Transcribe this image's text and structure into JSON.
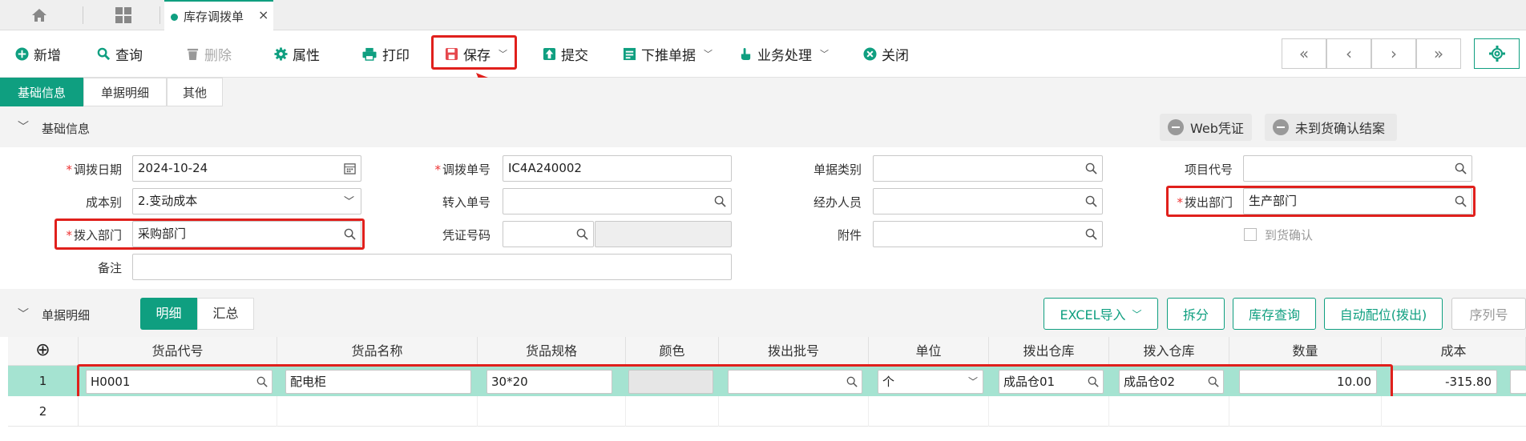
{
  "tabbar": {
    "active_tab": "库存调拨单",
    "close": "×"
  },
  "toolbar": {
    "add": "新增",
    "query": "查询",
    "delete": "删除",
    "properties": "属性",
    "print": "打印",
    "save": "保存",
    "submit": "提交",
    "push_down": "下推单据",
    "business": "业务处理",
    "close": "关闭",
    "nav_first": "«",
    "nav_prev": "‹",
    "nav_next": "›",
    "nav_last": "»"
  },
  "form_tabs": [
    "基础信息",
    "单据明细",
    "其他"
  ],
  "section_basic": {
    "title": "基础信息",
    "web_voucher": "Web凭证",
    "unarrived": "未到货确认结案"
  },
  "fields": {
    "date_label": "调拨日期",
    "date_value": "2024-10-24",
    "bill_no_label": "调拨单号",
    "bill_no_value": "IC4A240002",
    "bill_type_label": "单据类别",
    "bill_type_value": "",
    "project_label": "项目代号",
    "project_value": "",
    "cost_label": "成本别",
    "cost_value": "2.变动成本",
    "transfer_no_label": "转入单号",
    "transfer_no_value": "",
    "handler_label": "经办人员",
    "handler_value": "",
    "out_dept_label": "拨出部门",
    "out_dept_value": "生产部门",
    "in_dept_label": "拨入部门",
    "in_dept_value": "采购部门",
    "voucher_label": "凭证号码",
    "voucher_value": "",
    "attach_label": "附件",
    "attach_value": "",
    "arrival_label": "到货确认",
    "remark_label": "备注",
    "remark_value": ""
  },
  "section_detail": {
    "title": "单据明细",
    "tab_detail": "明细",
    "tab_summary": "汇总",
    "excel": "EXCEL导入",
    "split": "拆分",
    "stock_query": "库存查询",
    "auto_alloc": "自动配位(拨出)",
    "serial": "序列号"
  },
  "grid": {
    "add_icon": "⊕",
    "columns": [
      "货品代号",
      "货品名称",
      "货品规格",
      "颜色",
      "拨出批号",
      "单位",
      "拨出仓库",
      "拨入仓库",
      "数量",
      "成本"
    ],
    "rows": [
      {
        "no": "1",
        "code": "H0001",
        "name": "配电柜",
        "spec": "30*20",
        "color": "",
        "batch": "",
        "unit": "个",
        "out_wh": "成品仓01",
        "in_wh": "成品仓02",
        "qty": "10.00",
        "cost": "-315.80"
      },
      {
        "no": "2"
      }
    ]
  },
  "colors": {
    "accent": "#0f9f80",
    "highlight": "#e0201c",
    "row_selected": "#a5e3d1"
  }
}
